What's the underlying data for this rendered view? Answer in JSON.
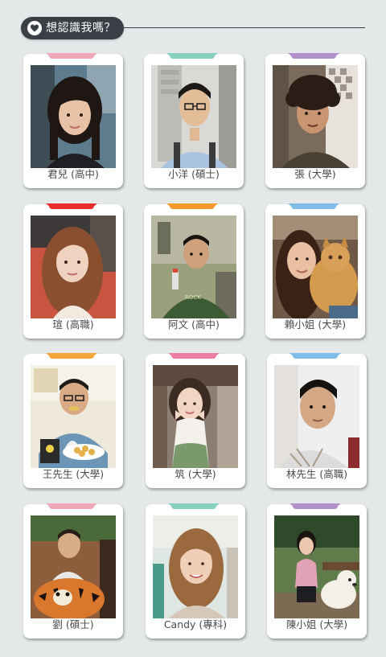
{
  "section": {
    "title": "想認識我嗎？",
    "icon": "heart-icon"
  },
  "profiles": [
    {
      "name": "君兒 (高中)",
      "tab_color": "#f2a7b8"
    },
    {
      "name": "小洋 (碩士)",
      "tab_color": "#86d1bf"
    },
    {
      "name": "張 (大學)",
      "tab_color": "#b08fcb"
    },
    {
      "name": "瑄 (高職)",
      "tab_color": "#e82c2c"
    },
    {
      "name": "阿文 (高中)",
      "tab_color": "#f59a2a"
    },
    {
      "name": "賴小姐 (大學)",
      "tab_color": "#7fbde6"
    },
    {
      "name": "王先生 (大學)",
      "tab_color": "#f4a63a"
    },
    {
      "name": "筑 (大學)",
      "tab_color": "#ec7fa1"
    },
    {
      "name": "林先生 (高職)",
      "tab_color": "#7fbde6"
    },
    {
      "name": "劉 (碩士)",
      "tab_color": "#f2a7b8"
    },
    {
      "name": "Candy (專科)",
      "tab_color": "#86d1bf"
    },
    {
      "name": "陳小姐 (大學)",
      "tab_color": "#b08fcb"
    }
  ]
}
